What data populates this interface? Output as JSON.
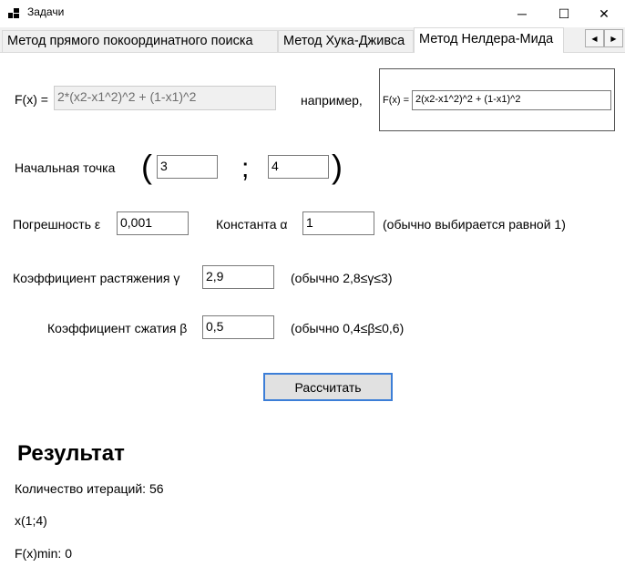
{
  "window": {
    "title": "Задачи",
    "minimize": "─",
    "maximize": "☐",
    "close": "✕"
  },
  "tabs": [
    {
      "label": "Метод прямого покоординатного поиска",
      "active": false
    },
    {
      "label": "Метод Хука-Дживса",
      "active": false
    },
    {
      "label": "Метод Нелдера-Мида",
      "active": true
    }
  ],
  "tab_scroll": {
    "left": "◀",
    "right": "▶"
  },
  "form": {
    "fx_label": "F(x)  =",
    "fx_value": "2*(x2-x1^2)^2 + (1-x1)^2",
    "example_label": "например,",
    "example_fx_label": "F(x)  =",
    "example_fx_value": "2(x2-x1^2)^2 + (1-x1)^2",
    "start_point_label": "Начальная точка",
    "open_paren": "(",
    "x1_value": "3",
    "separator": ";",
    "x2_value": "4",
    "close_paren": ")",
    "error_label": "Погрешность ε",
    "error_value": "0,001",
    "alpha_label": "Константа α",
    "alpha_value": "1",
    "alpha_hint": "(обычно выбирается равной 1)",
    "gamma_label": "Коэффициент растяжения  γ",
    "gamma_value": "2,9",
    "gamma_hint": "(обычно 2,8≤γ≤3)",
    "beta_label": "Коэффициент сжатия β",
    "beta_value": "0,5",
    "beta_hint": "(обычно 0,4≤β≤0,6)",
    "calculate_button": "Рассчитать"
  },
  "result": {
    "title": "Результат",
    "iterations": "Количество итераций: 56",
    "point": "x(1;4)",
    "fmin": "F(x)min: 0"
  }
}
